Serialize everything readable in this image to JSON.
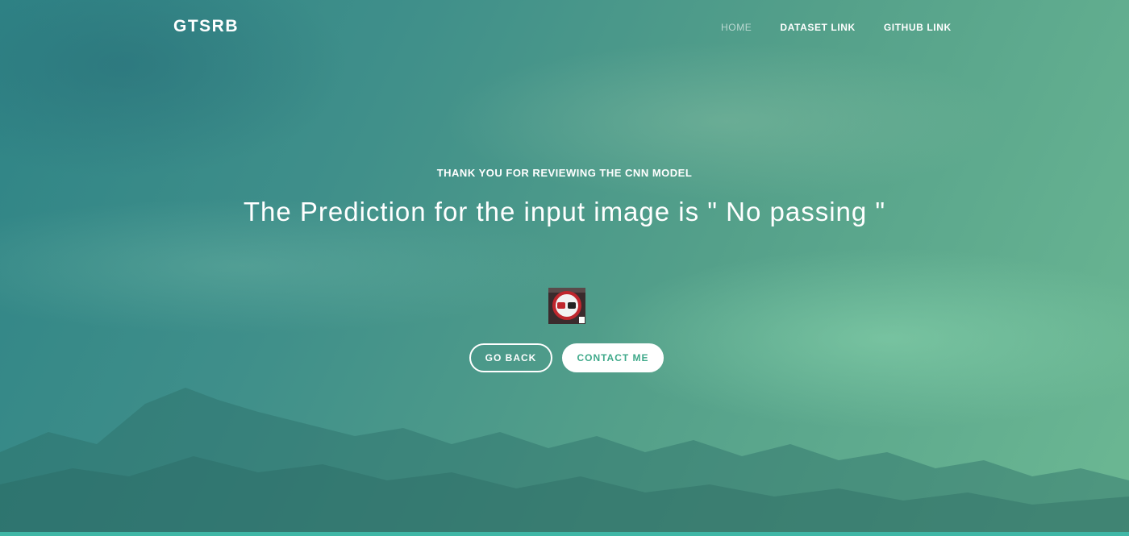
{
  "nav": {
    "brand": "GTSRB",
    "links": [
      {
        "label": "HOME",
        "active": true
      },
      {
        "label": "DATASET LINK",
        "active": false
      },
      {
        "label": "GITHUB LINK",
        "active": false
      }
    ]
  },
  "hero": {
    "subtitle": "THANK YOU FOR REVIEWING THE CNN MODEL",
    "headline": "The Prediction for the input image is \" No passing \"",
    "input_image_icon": "no-passing-sign-icon",
    "buttons": {
      "go_back": "GO BACK",
      "contact": "CONTACT ME"
    }
  },
  "colors": {
    "accent": "#3fa98a",
    "bottom_bar": "#3fb7a6",
    "text": "#ffffff"
  }
}
